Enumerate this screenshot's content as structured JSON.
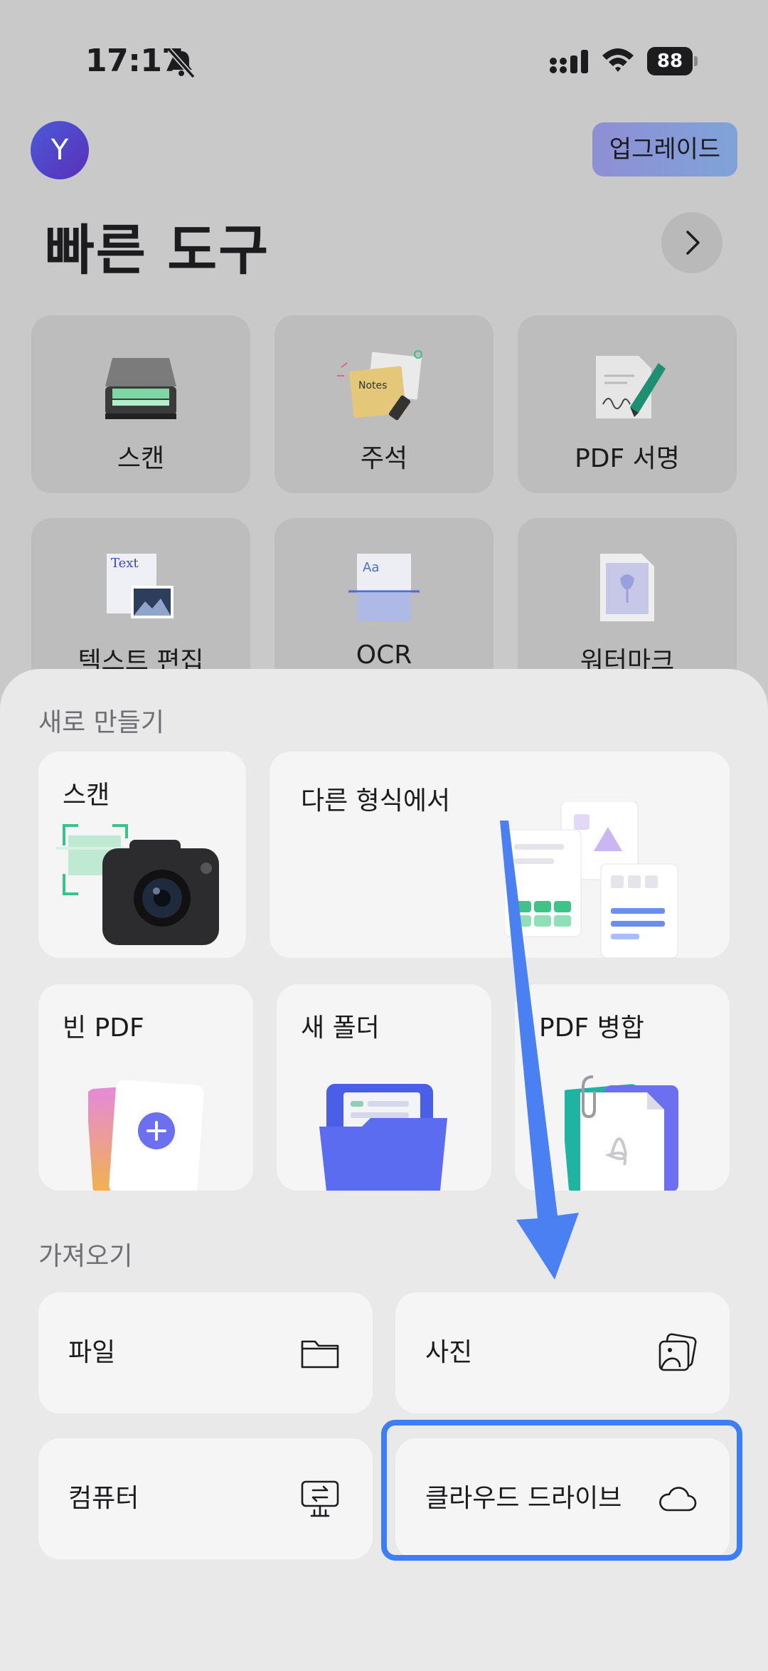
{
  "status_bar": {
    "time": "17:17",
    "battery": "88"
  },
  "header": {
    "avatar_letter": "Y",
    "upgrade_label": "업그레이드",
    "title": "빠른 도구"
  },
  "quick_tools": [
    {
      "label": "스캔"
    },
    {
      "label": "주석"
    },
    {
      "label": "PDF 서명"
    },
    {
      "label": "텍스트 편집"
    },
    {
      "label": "OCR"
    },
    {
      "label": "워터마크"
    }
  ],
  "annotation_notes_text": "Notes",
  "text_edit_icon_text": "Text",
  "ocr_icon_text": "Aa",
  "create": {
    "section_title": "새로 만들기",
    "scan_label": "스캔",
    "from_format_label": "다른 형식에서",
    "blank_pdf_label": "빈 PDF",
    "new_folder_label": "새 폴더",
    "merge_pdf_label": "PDF 병합"
  },
  "import": {
    "section_title": "가져오기",
    "file_label": "파일",
    "photo_label": "사진",
    "computer_label": "컴퓨터",
    "cloud_label": "클라우드 드라이브"
  },
  "colors": {
    "accent": "#3d7df5",
    "sheet_bg": "#e9e9ea",
    "card_bg": "#f5f5f6"
  }
}
